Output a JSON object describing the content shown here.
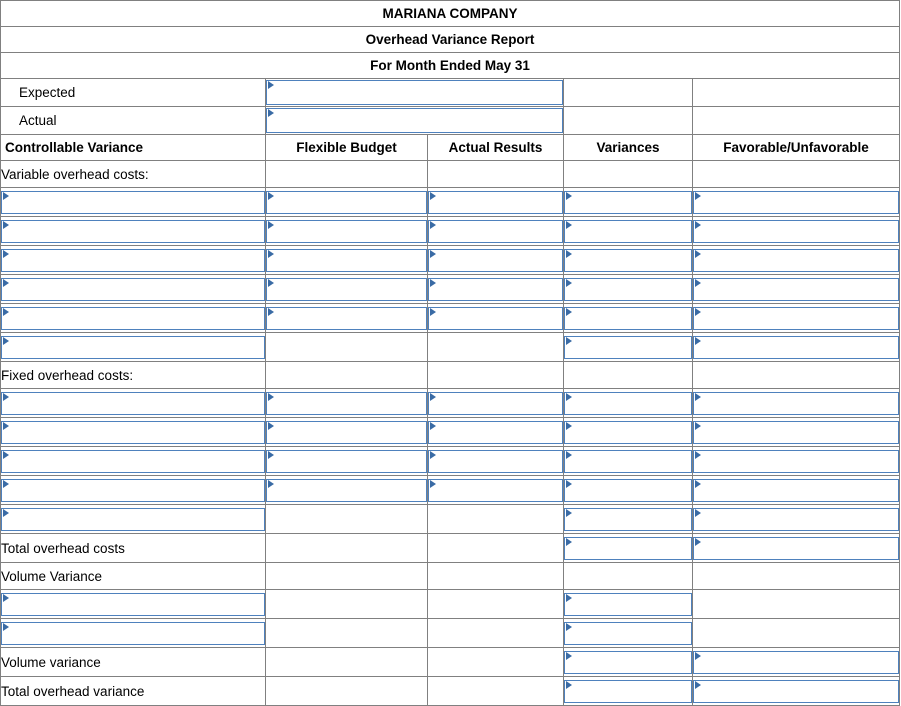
{
  "report": {
    "company": "MARIANA COMPANY",
    "title": "Overhead Variance Report",
    "period": "For Month Ended May 31"
  },
  "summary_rows": [
    {
      "label": "Expected",
      "input": true,
      "value": ""
    },
    {
      "label": "Actual",
      "input": true,
      "value": ""
    }
  ],
  "columns": [
    {
      "key": "controllable_variance",
      "label": "Controllable Variance",
      "align": "left"
    },
    {
      "key": "flexible_budget",
      "label": "Flexible Budget",
      "align": "center"
    },
    {
      "key": "actual_results",
      "label": "Actual Results",
      "align": "center"
    },
    {
      "key": "variances",
      "label": "Variances",
      "align": "center"
    },
    {
      "key": "favorable_unfavorable",
      "label": "Favorable/Unfavorable",
      "align": "center"
    }
  ],
  "section_headings": {
    "variable": "Variable overhead costs:",
    "fixed": "Fixed overhead costs:"
  },
  "footer_labels": {
    "total_overhead_costs": "Total overhead costs",
    "volume_variance_heading": "Volume Variance",
    "volume_variance": "Volume variance",
    "total_overhead_variance": "Total overhead variance"
  },
  "icons": {
    "input_marker": "input-flag-marker"
  },
  "colors": {
    "header_blue": "#74AADF",
    "input_border_blue": "#4E81BD",
    "grid_gray": "#808080",
    "rule_black": "#000000"
  },
  "input_placeholder": "",
  "values": {
    "expected": "",
    "actual": "",
    "variable_rows": [
      {
        "controllable_variance": "",
        "flexible_budget": "",
        "actual_results": "",
        "variances": "",
        "favorable_unfavorable": ""
      },
      {
        "controllable_variance": "",
        "flexible_budget": "",
        "actual_results": "",
        "variances": "",
        "favorable_unfavorable": ""
      },
      {
        "controllable_variance": "",
        "flexible_budget": "",
        "actual_results": "",
        "variances": "",
        "favorable_unfavorable": ""
      },
      {
        "controllable_variance": "",
        "flexible_budget": "",
        "actual_results": "",
        "variances": "",
        "favorable_unfavorable": ""
      },
      {
        "controllable_variance": "",
        "flexible_budget": "",
        "actual_results": "",
        "variances": "",
        "favorable_unfavorable": ""
      },
      {
        "controllable_variance": "",
        "flexible_budget": null,
        "actual_results": null,
        "variances": "",
        "favorable_unfavorable": ""
      }
    ],
    "fixed_rows": [
      {
        "controllable_variance": "",
        "flexible_budget": "",
        "actual_results": "",
        "variances": "",
        "favorable_unfavorable": ""
      },
      {
        "controllable_variance": "",
        "flexible_budget": "",
        "actual_results": "",
        "variances": "",
        "favorable_unfavorable": ""
      },
      {
        "controllable_variance": "",
        "flexible_budget": "",
        "actual_results": "",
        "variances": "",
        "favorable_unfavorable": ""
      },
      {
        "controllable_variance": "",
        "flexible_budget": "",
        "actual_results": "",
        "variances": "",
        "favorable_unfavorable": ""
      },
      {
        "controllable_variance": "",
        "flexible_budget": null,
        "actual_results": null,
        "variances": "",
        "favorable_unfavorable": ""
      }
    ],
    "total_overhead_costs": {
      "variances": "",
      "favorable_unfavorable": ""
    },
    "volume_rows": [
      {
        "controllable_variance": "",
        "variances": ""
      },
      {
        "controllable_variance": "",
        "variances": ""
      }
    ],
    "volume_variance": {
      "variances": "",
      "favorable_unfavorable": ""
    },
    "total_overhead_variance": {
      "variances": "",
      "favorable_unfavorable": ""
    }
  }
}
